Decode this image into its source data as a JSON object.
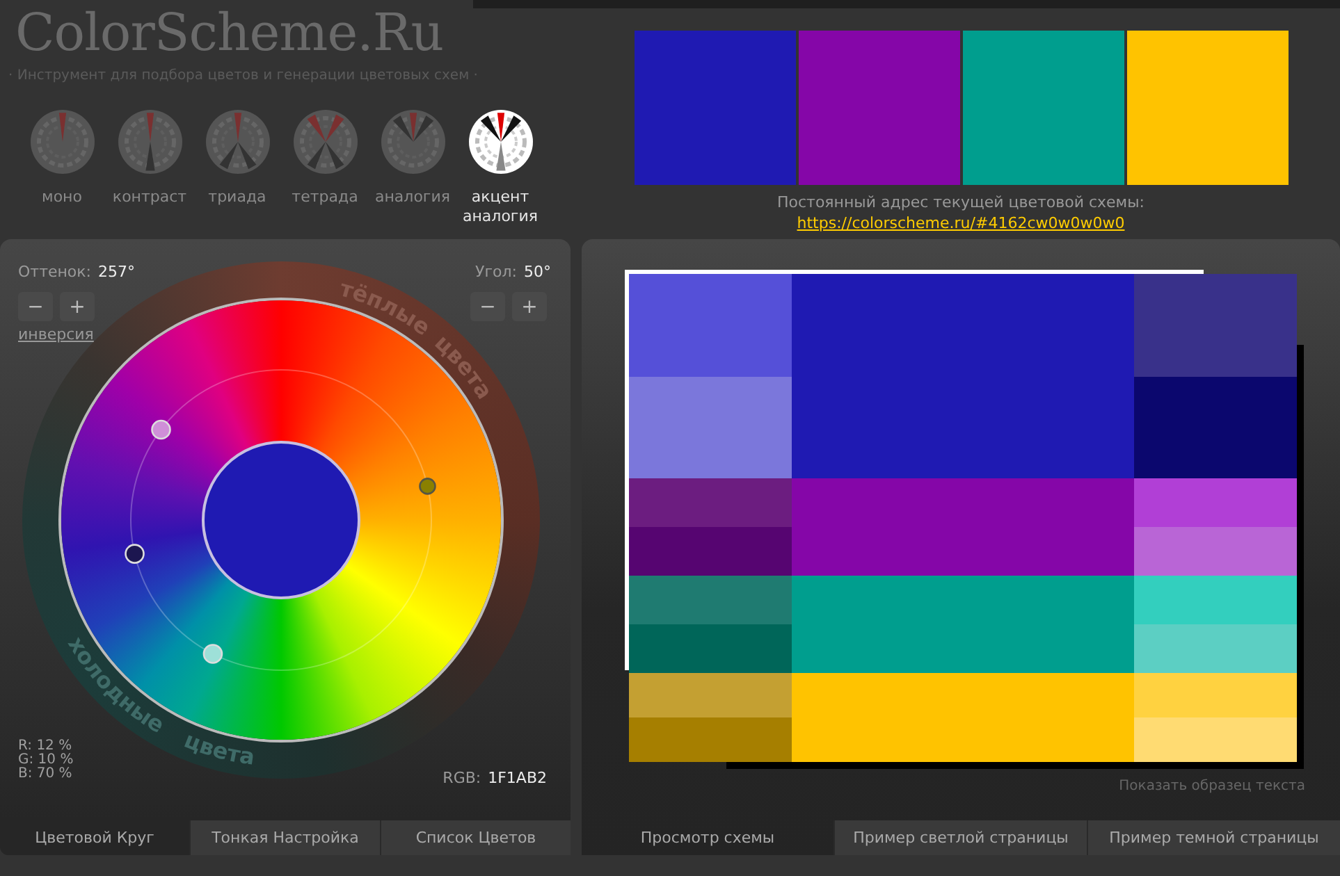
{
  "site": {
    "logo": "ColorScheme.Ru",
    "tagline": "· Инструмент для подбора цветов и генерации цветовых схем ·"
  },
  "schemes": [
    {
      "label": "моно",
      "kind": "mono",
      "selected": false
    },
    {
      "label": "контраст",
      "kind": "contrast",
      "selected": false
    },
    {
      "label": "триада",
      "kind": "triad",
      "selected": false
    },
    {
      "label": "тетрада",
      "kind": "tetrad",
      "selected": false
    },
    {
      "label": "аналогия",
      "kind": "analogy",
      "selected": false
    },
    {
      "label": "акцент аналогия",
      "kind": "accent",
      "selected": true
    }
  ],
  "wheel": {
    "hue_label": "Оттенок:",
    "hue": "257°",
    "angle_label": "Угол:",
    "angle": "50°",
    "hue_buttons": [
      "−",
      "+"
    ],
    "angle_buttons": [
      "−",
      "+"
    ],
    "invert_link": "инверсия",
    "warm_label": [
      "тёплые",
      "цвета"
    ],
    "cool_label": [
      "холодные",
      "цвета"
    ],
    "center": {
      "color": "#1f1ab2"
    },
    "markers": [
      {
        "kind": "base",
        "color": "#1c1650"
      },
      {
        "kind": "plus",
        "color": "#cf8fd8"
      },
      {
        "kind": "minus",
        "color": "#9ee0d8"
      },
      {
        "kind": "complement",
        "color": "#8a8000"
      }
    ],
    "rgb_percent": [
      "R: 12 %",
      "G: 10 %",
      "B: 70 %"
    ],
    "rgb_label": "RGB:",
    "rgb": "1F1AB2"
  },
  "left_tabs": [
    {
      "label": "Цветовой Круг",
      "selected": true
    },
    {
      "label": "Тонкая Настройка",
      "selected": false
    },
    {
      "label": "Список Цветов",
      "selected": false
    }
  ],
  "swatches": [
    {
      "color": "#1f1ab2"
    },
    {
      "color": "#8506a8"
    },
    {
      "color": "#009e8e"
    },
    {
      "color": "#ffc300"
    }
  ],
  "permalink": {
    "label": "Постоянный адрес текущей цветовой схемы:",
    "url": "https://colorscheme.ru/#4162cw0w0w0w0"
  },
  "preview": {
    "groups": [
      {
        "main": {
          "color": "#1f1ab2"
        },
        "light": [
          {
            "color": "#5550d8"
          },
          {
            "color": "#7b77db"
          }
        ],
        "dark": [
          {
            "color": "#39318a"
          },
          {
            "color": "#0b076e"
          }
        ]
      },
      {
        "main": {
          "color": "#8506a8"
        },
        "light": [
          {
            "color": "#6c1d80"
          },
          {
            "color": "#560571"
          }
        ],
        "dark": [
          {
            "color": "#b13fd6"
          },
          {
            "color": "#b965d6"
          }
        ]
      },
      {
        "main": {
          "color": "#009e8e"
        },
        "light": [
          {
            "color": "#1f7b71"
          },
          {
            "color": "#006659"
          }
        ],
        "dark": [
          {
            "color": "#33cfbe"
          },
          {
            "color": "#5ccfc3"
          }
        ]
      },
      {
        "main": {
          "color": "#ffc300"
        },
        "light": [
          {
            "color": "#c4a032"
          },
          {
            "color": "#a67f00"
          }
        ],
        "dark": [
          {
            "color": "#ffd240"
          },
          {
            "color": "#ffdb72"
          }
        ]
      }
    ],
    "sample_text_link": "Показать образец текста"
  },
  "right_tabs": [
    {
      "label": "Просмотр схемы",
      "selected": true
    },
    {
      "label": "Пример светлой страницы",
      "selected": false
    },
    {
      "label": "Пример темной страницы",
      "selected": false
    }
  ]
}
